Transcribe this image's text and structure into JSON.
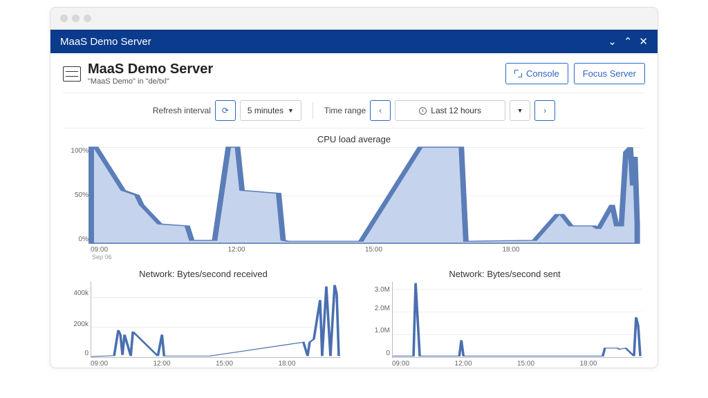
{
  "window": {
    "title": "MaaS Demo Server"
  },
  "header": {
    "title": "MaaS Demo Server",
    "subtitle": "\"MaaS Demo\" in \"de/txl\"",
    "console_btn": "Console",
    "focus_btn": "Focus Server"
  },
  "toolbar": {
    "refresh_label": "Refresh interval",
    "refresh_value": "5 minutes",
    "timerange_label": "Time range",
    "timerange_value": "Last 12 hours"
  },
  "chart_data": [
    {
      "type": "area",
      "title": "CPU load average",
      "xlabel": "",
      "ylabel": "",
      "x_ticks": [
        "09:00",
        "12:00",
        "15:00",
        "18:00"
      ],
      "x_sub": "Sep 06",
      "y_ticks": [
        "100%",
        "50%",
        "0%"
      ],
      "ylim": [
        0,
        100
      ],
      "series": [
        {
          "name": "cpu",
          "x_hours": [
            8.3,
            8.4,
            9.0,
            9.3,
            9.4,
            9.6,
            9.8,
            10.4,
            10.5,
            11.0,
            11.3,
            11.5,
            11.6,
            12.4,
            12.5,
            12.6,
            12.8,
            14.0,
            14.2,
            15.5,
            15.6,
            16.4,
            16.5,
            18.0,
            18.5,
            18.6,
            18.8,
            19.3,
            19.4,
            19.7,
            19.8,
            19.9,
            20.0,
            20.1,
            20.15,
            20.2,
            20.25
          ],
          "values": [
            100,
            100,
            55,
            50,
            40,
            30,
            20,
            18,
            3,
            3,
            100,
            100,
            55,
            52,
            3,
            2,
            2,
            2,
            2,
            100,
            100,
            100,
            2,
            3,
            30,
            30,
            18,
            18,
            15,
            40,
            18,
            18,
            95,
            100,
            60,
            90,
            20
          ]
        }
      ]
    },
    {
      "type": "line",
      "title": "Network: Bytes/second received",
      "x_ticks": [
        "09:00",
        "12:00",
        "15:00",
        "18:00"
      ],
      "y_ticks": [
        "400k",
        "200k",
        "0"
      ],
      "ylim": [
        0,
        500000
      ],
      "series": [
        {
          "name": "rx",
          "x_hours": [
            8.3,
            9.4,
            9.6,
            9.7,
            9.8,
            9.9,
            10.2,
            10.3,
            11.5,
            11.7,
            11.8,
            12.0,
            14.0,
            18.5,
            18.7,
            18.8,
            19.0,
            19.3,
            19.4,
            19.6,
            19.8,
            20.0,
            20.1,
            20.2
          ],
          "values": [
            5000,
            10000,
            180000,
            150000,
            15000,
            150000,
            8000,
            170000,
            8000,
            150000,
            8000,
            8000,
            8000,
            100000,
            8000,
            100000,
            120000,
            380000,
            8000,
            470000,
            8000,
            480000,
            420000,
            8000
          ]
        }
      ]
    },
    {
      "type": "line",
      "title": "Network: Bytes/second sent",
      "x_ticks": [
        "09:00",
        "12:00",
        "15:00",
        "18:00"
      ],
      "y_ticks": [
        "3.0M",
        "2.0M",
        "1.0M",
        "0"
      ],
      "ylim": [
        0,
        3300000
      ],
      "series": [
        {
          "name": "tx",
          "x_hours": [
            8.3,
            9.3,
            9.4,
            9.6,
            11.5,
            11.6,
            11.7,
            12.0,
            18.4,
            18.5,
            19.1,
            19.2,
            19.5,
            19.9,
            20.0,
            20.1,
            20.2
          ],
          "values": [
            50000,
            50000,
            3250000,
            50000,
            50000,
            750000,
            50000,
            50000,
            50000,
            400000,
            400000,
            350000,
            400000,
            50000,
            1750000,
            1400000,
            50000
          ]
        }
      ]
    }
  ]
}
